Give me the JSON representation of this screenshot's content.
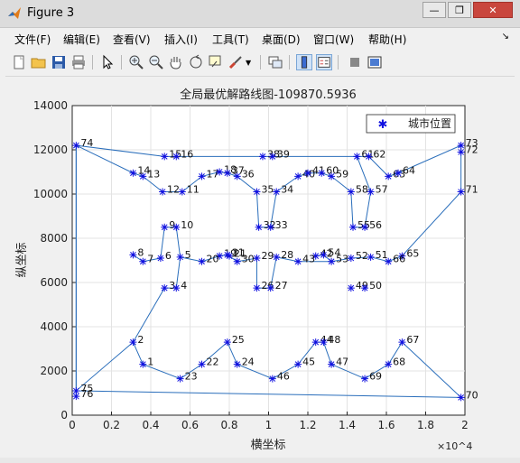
{
  "window": {
    "title": "Figure 3",
    "controls": [
      "minimize",
      "restore",
      "close"
    ]
  },
  "menu": [
    "文件(F)",
    "编辑(E)",
    "查看(V)",
    "插入(I)",
    "工具(T)",
    "桌面(D)",
    "窗口(W)",
    "帮助(H)"
  ],
  "toolbar": [
    "new-figure",
    "open-file",
    "save",
    "print",
    "select-arrow",
    "zoom-in",
    "zoom-out",
    "pan",
    "rotate-3d",
    "data-cursor",
    "brush",
    "brush-dropdown",
    "link-plot",
    "colorbar",
    "legend",
    "hide-plot-tools",
    "show-plot-tools"
  ],
  "colors": {
    "line": "#2a6ebb",
    "marker": "#1010e0"
  },
  "chart_data": {
    "type": "line",
    "title": "全局最优解路线图-109870.5936",
    "xlabel": "横坐标",
    "ylabel": "纵坐标",
    "x_exponent": "×10^4",
    "xlim": [
      0,
      2
    ],
    "ylim": [
      0,
      14000
    ],
    "x_ticks": [
      "0",
      "0.2",
      "0.4",
      "0.6",
      "0.8",
      "1",
      "1.2",
      "1.4",
      "1.6",
      "1.8",
      "2"
    ],
    "y_ticks": [
      "0",
      "2000",
      "4000",
      "6000",
      "8000",
      "10000",
      "12000",
      "14000"
    ],
    "grid": true,
    "legend": {
      "label": "城市位置",
      "position": "top-right"
    },
    "cities": [
      {
        "id": "1",
        "x": 0.36,
        "y": 2300
      },
      {
        "id": "2",
        "x": 0.31,
        "y": 3300
      },
      {
        "id": "3",
        "x": 0.47,
        "y": 5750
      },
      {
        "id": "4",
        "x": 0.53,
        "y": 5750
      },
      {
        "id": "5",
        "x": 0.55,
        "y": 7150
      },
      {
        "id": "6",
        "x": 0.45,
        "y": 7100
      },
      {
        "id": "7",
        "x": 0.36,
        "y": 6950
      },
      {
        "id": "8",
        "x": 0.31,
        "y": 7250
      },
      {
        "id": "9",
        "x": 0.47,
        "y": 8500
      },
      {
        "id": "10",
        "x": 0.53,
        "y": 8500
      },
      {
        "id": "11",
        "x": 0.56,
        "y": 10100
      },
      {
        "id": "12",
        "x": 0.46,
        "y": 10100
      },
      {
        "id": "13",
        "x": 0.36,
        "y": 10800
      },
      {
        "id": "14",
        "x": 0.31,
        "y": 10950
      },
      {
        "id": "15",
        "x": 0.47,
        "y": 11700
      },
      {
        "id": "16",
        "x": 0.53,
        "y": 11700
      },
      {
        "id": "17",
        "x": 0.66,
        "y": 10800
      },
      {
        "id": "18",
        "x": 0.75,
        "y": 11000
      },
      {
        "id": "19",
        "x": 0.75,
        "y": 7200
      },
      {
        "id": "20",
        "x": 0.66,
        "y": 6950
      },
      {
        "id": "21",
        "x": 0.8,
        "y": 7200
      },
      {
        "id": "22",
        "x": 0.66,
        "y": 2300
      },
      {
        "id": "23",
        "x": 0.55,
        "y": 1650
      },
      {
        "id": "24",
        "x": 0.84,
        "y": 2300
      },
      {
        "id": "25",
        "x": 0.79,
        "y": 3300
      },
      {
        "id": "26",
        "x": 0.94,
        "y": 5750
      },
      {
        "id": "27",
        "x": 1.01,
        "y": 5750
      },
      {
        "id": "28",
        "x": 1.04,
        "y": 7150
      },
      {
        "id": "29",
        "x": 0.94,
        "y": 7100
      },
      {
        "id": "30",
        "x": 0.84,
        "y": 6950
      },
      {
        "id": "31",
        "x": 0.79,
        "y": 7250
      },
      {
        "id": "32",
        "x": 0.95,
        "y": 8500
      },
      {
        "id": "33",
        "x": 1.01,
        "y": 8500
      },
      {
        "id": "34",
        "x": 1.04,
        "y": 10100
      },
      {
        "id": "35",
        "x": 0.94,
        "y": 10100
      },
      {
        "id": "36",
        "x": 0.84,
        "y": 10800
      },
      {
        "id": "37",
        "x": 0.79,
        "y": 10950
      },
      {
        "id": "38",
        "x": 0.97,
        "y": 11700
      },
      {
        "id": "39",
        "x": 1.02,
        "y": 11700
      },
      {
        "id": "40",
        "x": 1.15,
        "y": 10800
      },
      {
        "id": "41",
        "x": 1.2,
        "y": 10950
      },
      {
        "id": "42",
        "x": 1.24,
        "y": 7200
      },
      {
        "id": "43",
        "x": 1.15,
        "y": 6950
      },
      {
        "id": "44",
        "x": 1.24,
        "y": 3300
      },
      {
        "id": "45",
        "x": 1.15,
        "y": 2300
      },
      {
        "id": "46",
        "x": 1.02,
        "y": 1650
      },
      {
        "id": "47",
        "x": 1.32,
        "y": 2300
      },
      {
        "id": "48",
        "x": 1.28,
        "y": 3300
      },
      {
        "id": "49",
        "x": 1.42,
        "y": 5750
      },
      {
        "id": "50",
        "x": 1.49,
        "y": 5750
      },
      {
        "id": "51",
        "x": 1.52,
        "y": 7150
      },
      {
        "id": "52",
        "x": 1.42,
        "y": 7100
      },
      {
        "id": "53",
        "x": 1.32,
        "y": 6950
      },
      {
        "id": "54",
        "x": 1.28,
        "y": 7250
      },
      {
        "id": "55",
        "x": 1.43,
        "y": 8500
      },
      {
        "id": "56",
        "x": 1.49,
        "y": 8500
      },
      {
        "id": "57",
        "x": 1.52,
        "y": 10100
      },
      {
        "id": "58",
        "x": 1.42,
        "y": 10100
      },
      {
        "id": "59",
        "x": 1.32,
        "y": 10800
      },
      {
        "id": "60",
        "x": 1.27,
        "y": 10950
      },
      {
        "id": "61",
        "x": 1.45,
        "y": 11700
      },
      {
        "id": "62",
        "x": 1.51,
        "y": 11700
      },
      {
        "id": "63",
        "x": 1.61,
        "y": 10800
      },
      {
        "id": "64",
        "x": 1.66,
        "y": 10950
      },
      {
        "id": "65",
        "x": 1.68,
        "y": 7200
      },
      {
        "id": "66",
        "x": 1.61,
        "y": 6950
      },
      {
        "id": "67",
        "x": 1.68,
        "y": 3300
      },
      {
        "id": "68",
        "x": 1.61,
        "y": 2300
      },
      {
        "id": "69",
        "x": 1.49,
        "y": 1650
      },
      {
        "id": "70",
        "x": 1.98,
        "y": 800
      },
      {
        "id": "71",
        "x": 1.98,
        "y": 10100
      },
      {
        "id": "72",
        "x": 1.98,
        "y": 11900
      },
      {
        "id": "73",
        "x": 1.98,
        "y": 12200
      },
      {
        "id": "74",
        "x": 0.02,
        "y": 12200
      },
      {
        "id": "75",
        "x": 0.02,
        "y": 1100
      },
      {
        "id": "76",
        "x": 0.02,
        "y": 850
      }
    ],
    "route": [
      "74",
      "15",
      "16",
      "38",
      "39",
      "61",
      "62",
      "63",
      "64",
      "73",
      "72",
      "71",
      "65",
      "66",
      "51",
      "52",
      "53",
      "43",
      "28",
      "27",
      "26",
      "29",
      "30",
      "31",
      "19",
      "20",
      "5",
      "4",
      "3",
      "2",
      "1",
      "23",
      "22",
      "25",
      "24",
      "46",
      "45",
      "44",
      "48",
      "47",
      "69",
      "68",
      "67",
      "70",
      "75",
      "76",
      "74"
    ],
    "route_extra": [
      [
        "74",
        "14",
        "13",
        "12",
        "11",
        "17",
        "18",
        "37",
        "36",
        "35",
        "32",
        "33",
        "34",
        "40",
        "41",
        "60",
        "59",
        "58",
        "55",
        "56",
        "57",
        "61"
      ],
      [
        "74",
        "76",
        "75",
        "2"
      ],
      [
        "8",
        "7",
        "6",
        "9",
        "10",
        "5"
      ],
      [
        "42",
        "54",
        "53"
      ]
    ]
  }
}
